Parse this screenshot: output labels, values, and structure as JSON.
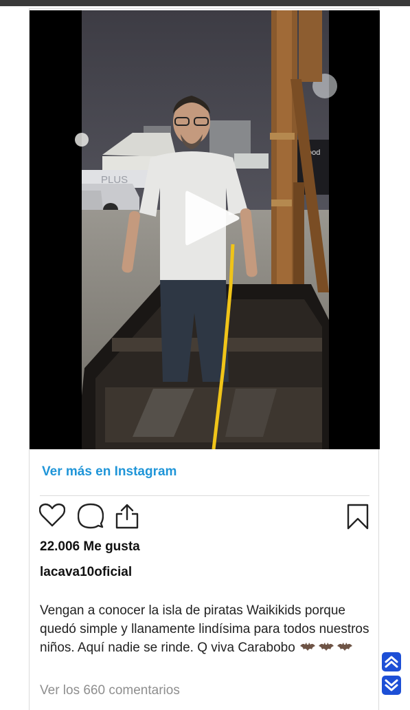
{
  "post": {
    "view_more_label": "Ver más en Instagram",
    "likes_text": "22.006 Me gusta",
    "username": "lacava10oficial",
    "caption_text": "Vengan a conocer la isla de piratas Waikikids porque quedó simple y llanamente lindísima para todos nuestros niños. Aquí nadie se rinde. Q viva Carabobo",
    "caption_emoji": "🦇🦇🦇",
    "comments_link": "Ver los 660 comentarios"
  },
  "video": {
    "background_signage": [
      "PLUS",
      "food"
    ]
  },
  "icons": {
    "like": "heart-icon",
    "comment": "comment-bubble-icon",
    "share": "share-icon",
    "save": "bookmark-icon",
    "play": "play-icon",
    "scroll_up": "chevron-up-icon",
    "scroll_down": "chevron-down-icon"
  },
  "colors": {
    "link_blue": "#1f95d8",
    "scroll_button_blue": "#1d4fd6",
    "text_dark": "#111111",
    "text_muted": "#8e8e8e",
    "border": "#dbdbdb"
  }
}
